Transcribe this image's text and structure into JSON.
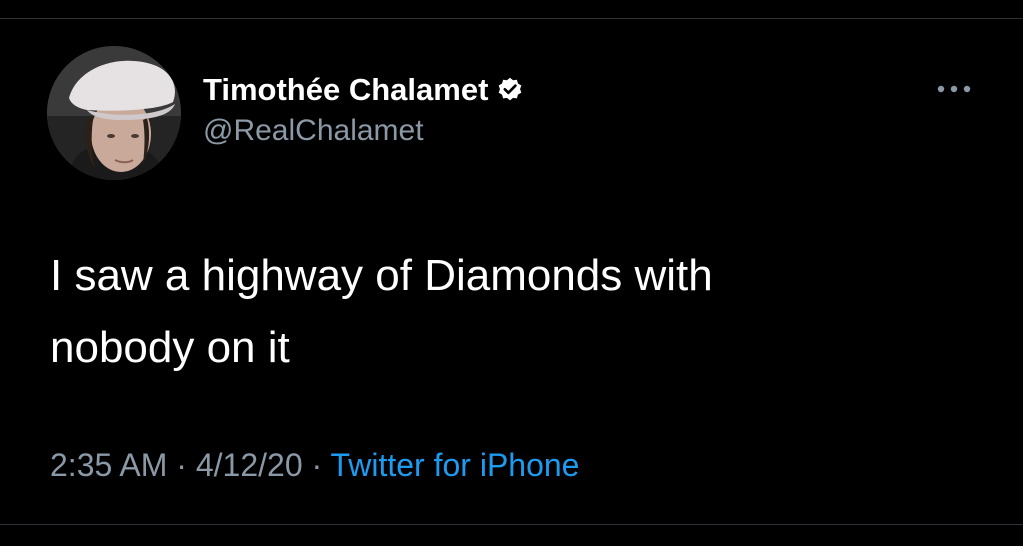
{
  "tweet": {
    "author": {
      "display_name": "Timothée Chalamet",
      "handle": "@RealChalamet",
      "verified": true,
      "avatar_icon": "profile-photo"
    },
    "text": "I saw a highway of Diamonds with\nnobody on it",
    "meta": {
      "time": "2:35 AM",
      "separator": "·",
      "date": "4/12/20",
      "source": "Twitter for iPhone"
    },
    "more_icon": "more-horizontal-icon"
  },
  "colors": {
    "background": "#000000",
    "primary_text": "#ffffff",
    "secondary_text": "#8b98a5",
    "link": "#1d9bf0",
    "divider": "#2f3336",
    "verified_badge": "#ffffff"
  }
}
